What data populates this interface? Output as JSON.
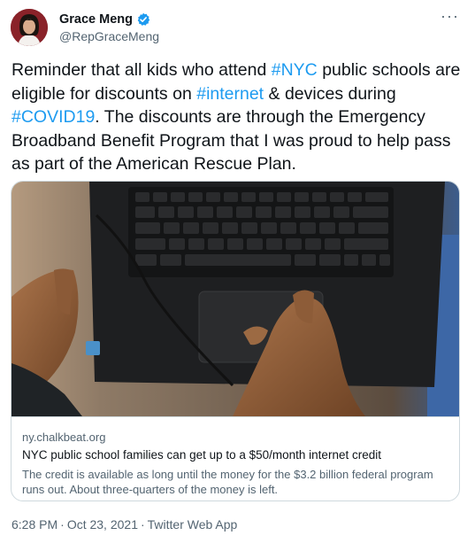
{
  "author": {
    "name": "Grace Meng",
    "handle": "@RepGraceMeng"
  },
  "more_label": "···",
  "tweet": {
    "t1": "Reminder that all kids who attend ",
    "h1": "#NYC",
    "t2": " public schools are eligible for discounts on ",
    "h2": "#internet",
    "t3": " & devices during ",
    "h3": "#COVID19",
    "t4": ". The discounts are through the Emergency Broadband Benefit Program that I was proud to help pass as part of the American Rescue Plan."
  },
  "card": {
    "domain": "ny.chalkbeat.org",
    "title": "NYC public school families can get up to a $50/month internet credit",
    "description": "The credit is available as long until the money for the $3.2 billion federal program runs out. About three-quarters of the money is left."
  },
  "meta": {
    "time": "6:28 PM",
    "separator": "·",
    "date": "Oct 23, 2021",
    "source": "Twitter Web App"
  },
  "colors": {
    "link": "#1d9bf0",
    "secondary_text": "#536471",
    "border": "#cfd9de"
  }
}
